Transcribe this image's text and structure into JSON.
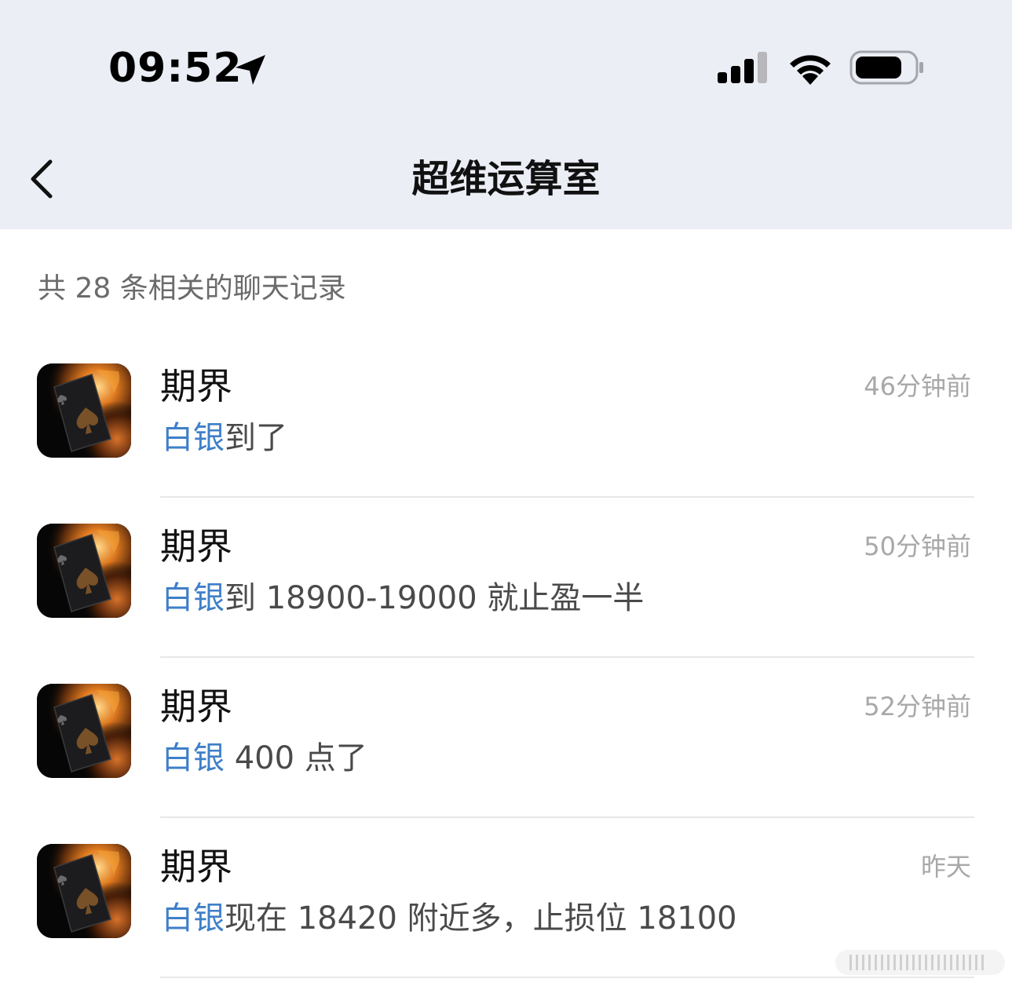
{
  "status_bar": {
    "time": "09:52",
    "icons": [
      "location-arrow-icon",
      "cellular-signal-icon",
      "wifi-icon",
      "battery-icon"
    ]
  },
  "nav": {
    "back_icon": "chevron-left-icon",
    "title": "超维运算室"
  },
  "summary": "共 28 条相关的聊天记录",
  "highlight_color": "#3f7fc8",
  "results": [
    {
      "sender": "期界",
      "time": "46分钟前",
      "keyword": "白银",
      "rest": "到了"
    },
    {
      "sender": "期界",
      "time": "50分钟前",
      "keyword": "白银",
      "rest": "到 18900-19000 就止盈一半"
    },
    {
      "sender": "期界",
      "time": "52分钟前",
      "keyword": "白银",
      "rest": " 400 点了"
    },
    {
      "sender": "期界",
      "time": "昨天",
      "keyword": "白银",
      "rest": "现在 18420 附近多，止损位 18100"
    }
  ]
}
